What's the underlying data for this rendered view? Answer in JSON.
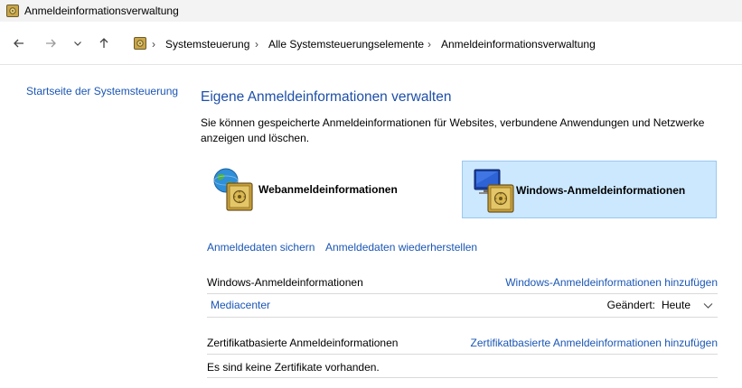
{
  "window": {
    "title": "Anmeldeinformationsverwaltung"
  },
  "breadcrumb": {
    "items": [
      "Systemsteuerung",
      "Alle Systemsteuerungselemente",
      "Anmeldeinformationsverwaltung"
    ]
  },
  "sidebar": {
    "home_link": "Startseite der Systemsteuerung"
  },
  "main": {
    "heading": "Eigene Anmeldeinformationen verwalten",
    "description": "Sie können gespeicherte Anmeldeinformationen für Websites, verbundene Anwendungen und Netzwerke anzeigen und löschen.",
    "tiles": {
      "web": "Webanmeldeinformationen",
      "windows": "Windows-Anmeldeinformationen"
    },
    "backup_link": "Anmeldedaten sichern",
    "restore_link": "Anmeldedaten wiederherstellen",
    "windows_section": {
      "title": "Windows-Anmeldeinformationen",
      "add_link": "Windows-Anmeldeinformationen hinzufügen",
      "entries": [
        {
          "name": "Mediacenter",
          "changed_label": "Geändert:",
          "changed_value": "Heute"
        }
      ]
    },
    "cert_section": {
      "title": "Zertifikatbasierte Anmeldeinformationen",
      "add_link": "Zertifikatbasierte Anmeldeinformationen hinzufügen",
      "empty_text": "Es sind keine Zertifikate vorhanden."
    }
  },
  "colors": {
    "accent_link": "#1a56b5",
    "heading": "#1e4fa8",
    "selected_tile_bg": "#cce8ff",
    "selected_tile_border": "#99c9ef"
  },
  "icons": {
    "app": "credential-manager-icon",
    "back": "arrow-left-icon",
    "forward": "arrow-right-icon",
    "recent": "chevron-down-icon",
    "up": "arrow-up-icon",
    "web_tile": "globe-safe-icon",
    "windows_tile": "monitor-safe-icon",
    "expand": "chevron-down-icon"
  }
}
